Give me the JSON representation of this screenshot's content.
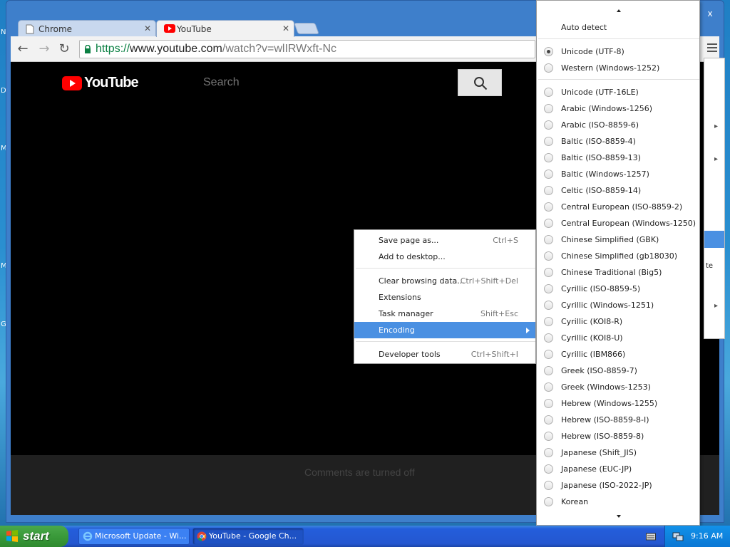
{
  "desktop": {
    "edge_letters": [
      "N",
      "D",
      "M",
      "M",
      "G"
    ]
  },
  "browser": {
    "tabs": [
      {
        "title": "Chrome",
        "active": false
      },
      {
        "title": "YouTube",
        "active": true
      }
    ],
    "close_glyph": "x",
    "omnibox": {
      "scheme": "https://",
      "host": "www.youtube.com",
      "path": "/watch?v=wlIRWxft-Nc"
    }
  },
  "page": {
    "logo_text": "YouTube",
    "search_placeholder": "Search",
    "comments_text": "Comments are turned off"
  },
  "main_menu_peek": {
    "partial_text": "te"
  },
  "context_menu": {
    "items": [
      {
        "label": "Save page as...",
        "shortcut": "Ctrl+S"
      },
      {
        "label": "Add to desktop...",
        "shortcut": ""
      },
      {
        "label": "Clear browsing data...",
        "shortcut": "Ctrl+Shift+Del"
      },
      {
        "label": "Extensions",
        "shortcut": ""
      },
      {
        "label": "Task manager",
        "shortcut": "Shift+Esc"
      },
      {
        "label": "Encoding",
        "shortcut": "",
        "highlighted": true,
        "submenu": true
      },
      {
        "label": "Developer tools",
        "shortcut": "Ctrl+Shift+I"
      }
    ]
  },
  "encoding_menu": {
    "auto_detect": "Auto detect",
    "selected": "Unicode (UTF-8)",
    "recent": [
      "Unicode (UTF-8)",
      "Western (Windows-1252)"
    ],
    "all": [
      "Unicode (UTF-16LE)",
      "Arabic (Windows-1256)",
      "Arabic (ISO-8859-6)",
      "Baltic (ISO-8859-4)",
      "Baltic (ISO-8859-13)",
      "Baltic (Windows-1257)",
      "Celtic (ISO-8859-14)",
      "Central European (ISO-8859-2)",
      "Central European (Windows-1250)",
      "Chinese Simplified (GBK)",
      "Chinese Simplified (gb18030)",
      "Chinese Traditional (Big5)",
      "Cyrillic (ISO-8859-5)",
      "Cyrillic (Windows-1251)",
      "Cyrillic (KOI8-R)",
      "Cyrillic (KOI8-U)",
      "Cyrillic (IBM866)",
      "Greek (ISO-8859-7)",
      "Greek (Windows-1253)",
      "Hebrew (Windows-1255)",
      "Hebrew (ISO-8859-8-I)",
      "Hebrew (ISO-8859-8)",
      "Japanese (Shift_JIS)",
      "Japanese (EUC-JP)",
      "Japanese (ISO-2022-JP)",
      "Korean"
    ]
  },
  "taskbar": {
    "start_label": "start",
    "buttons": [
      {
        "label": "Microsoft Update - Wi...",
        "icon": "ie-icon",
        "active": false
      },
      {
        "label": "YouTube - Google Ch...",
        "icon": "chrome-icon",
        "active": true
      }
    ],
    "clock": "9:16 AM"
  },
  "colors": {
    "menu_highlight": "#4a90e2",
    "youtube_red": "#ff0000",
    "secure_green": "#0b8043"
  }
}
